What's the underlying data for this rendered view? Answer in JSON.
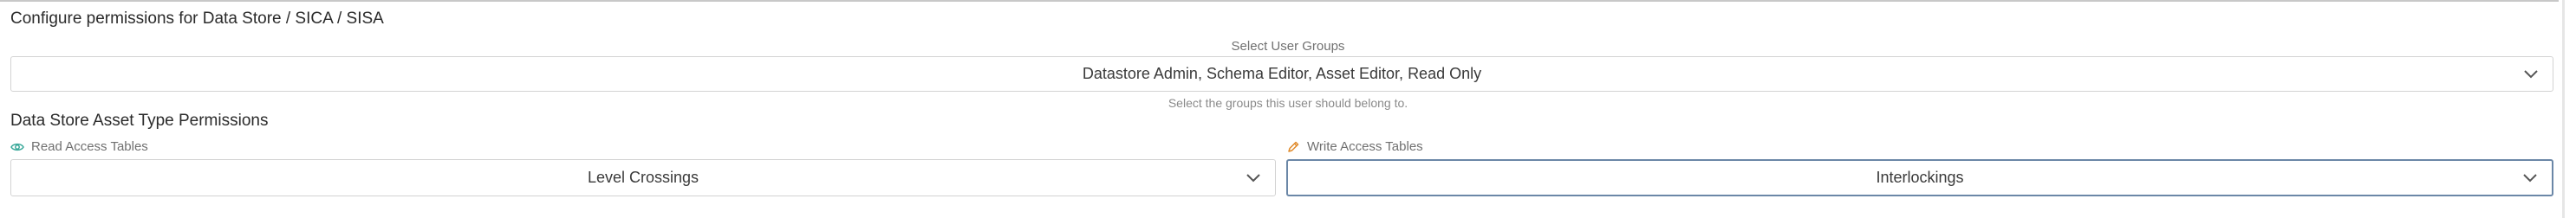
{
  "header": {
    "title": "Configure permissions for Data Store / SICA / SISA"
  },
  "user_groups": {
    "label": "Select User Groups",
    "value": "Datastore Admin, Schema Editor, Asset Editor, Read Only",
    "helper": "Select the groups this user should belong to."
  },
  "asset_permissions": {
    "title": "Data Store Asset Type Permissions",
    "read": {
      "label": "Read Access Tables",
      "value": "Level Crossings",
      "icon": "eye-icon",
      "icon_color": "#3aa99a"
    },
    "write": {
      "label": "Write Access Tables",
      "value": "Interlockings",
      "icon": "pencil-icon",
      "icon_color": "#e08a2b"
    }
  }
}
